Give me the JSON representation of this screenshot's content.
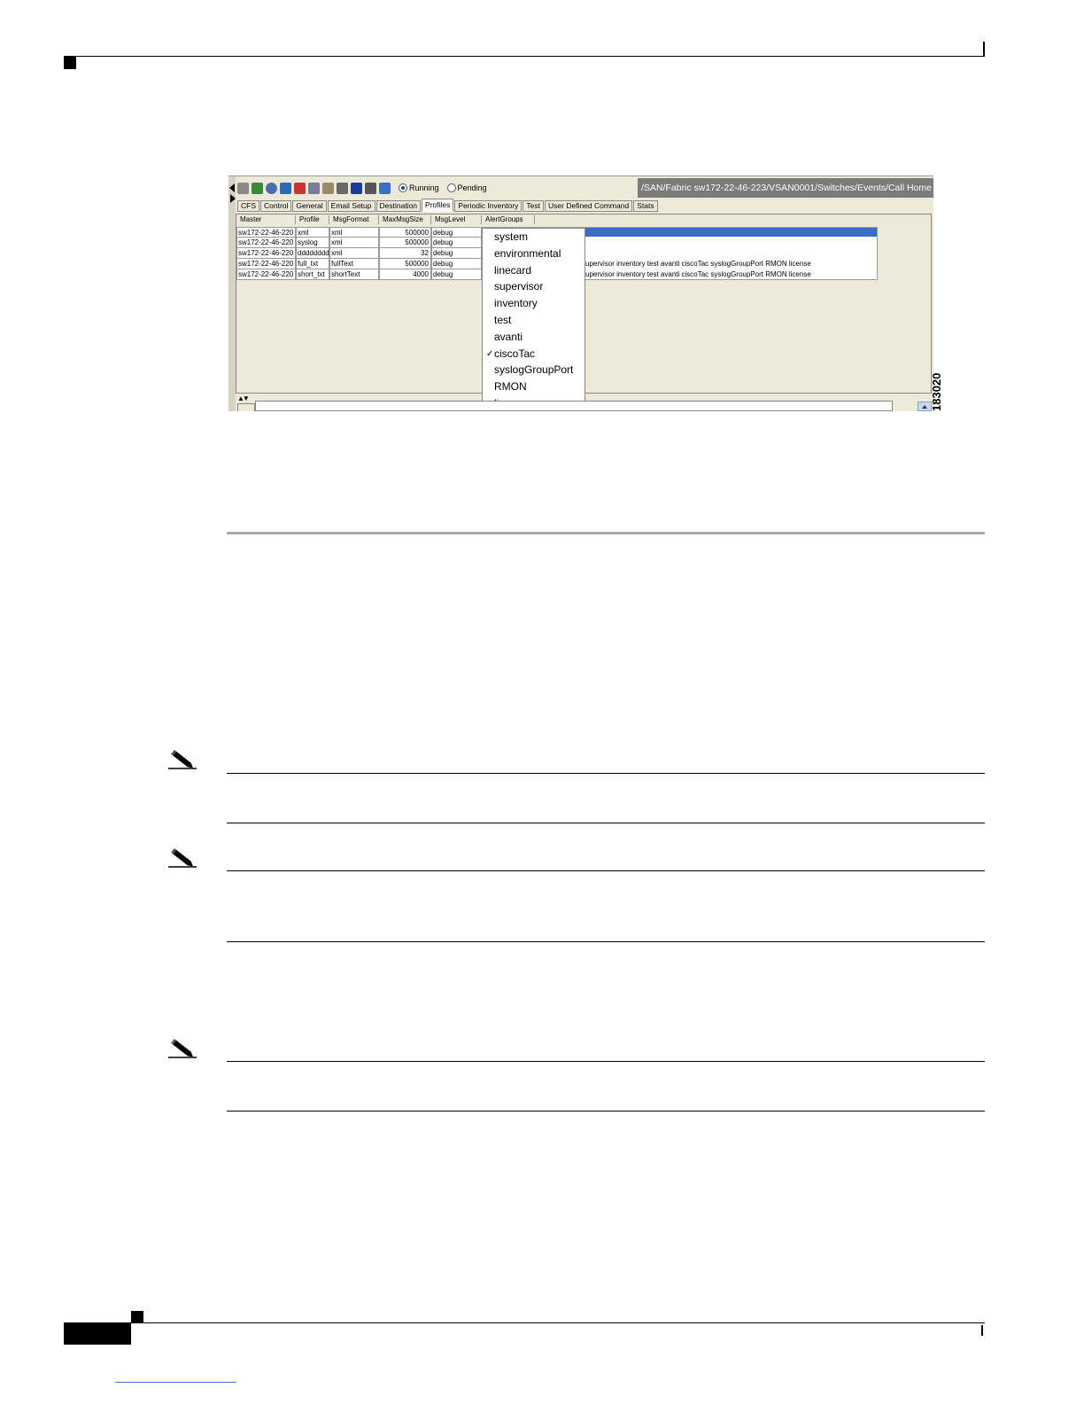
{
  "screenshot": {
    "toolbar": {
      "radio_running": "Running",
      "radio_pending": "Pending",
      "path": "/SAN/Fabric sw172-22-46-223/VSAN0001/Switches/Events/Call Home"
    },
    "tabs": [
      "CFS",
      "Control",
      "General",
      "Email Setup",
      "Destination",
      "Profiles",
      "Periodic Inventory",
      "Test",
      "User Defined Command",
      "Stats"
    ],
    "active_tab": "Profiles",
    "columns": [
      "Master",
      "Profile",
      "MsgFormat",
      "MaxMsgSize",
      "MsgLevel",
      "AlertGroups"
    ],
    "rows": [
      {
        "master": "sw172-22-46-220",
        "profile": "xml",
        "format": "xml",
        "size": "500000",
        "level": "debug",
        "groups": ""
      },
      {
        "master": "sw172-22-46-220",
        "profile": "syslog",
        "format": "xml",
        "size": "500000",
        "level": "debug",
        "groups": ""
      },
      {
        "master": "sw172-22-46-220",
        "profile": "dddddddd",
        "format": "xml",
        "size": "32",
        "level": "debug",
        "groups": ""
      },
      {
        "master": "sw172-22-46-220",
        "profile": "full_txt",
        "format": "fullText",
        "size": "500000",
        "level": "debug",
        "groups": "upervisor inventory test avanti ciscoTac syslogGroupPort RMON license"
      },
      {
        "master": "sw172-22-46-220",
        "profile": "short_txt",
        "format": "shortText",
        "size": "4000",
        "level": "debug",
        "groups": "upervisor inventory test avanti ciscoTac syslogGroupPort RMON license"
      }
    ],
    "dropdown": {
      "items": [
        "system",
        "environmental",
        "linecard",
        "supervisor",
        "inventory",
        "test",
        "avanti",
        "ciscoTac",
        "syslogGroupPort",
        "RMON",
        "license"
      ],
      "checked": "ciscoTac",
      "check_glyph": "✓"
    },
    "scroll_arrows": "▲▼",
    "figure_id": "183020"
  }
}
